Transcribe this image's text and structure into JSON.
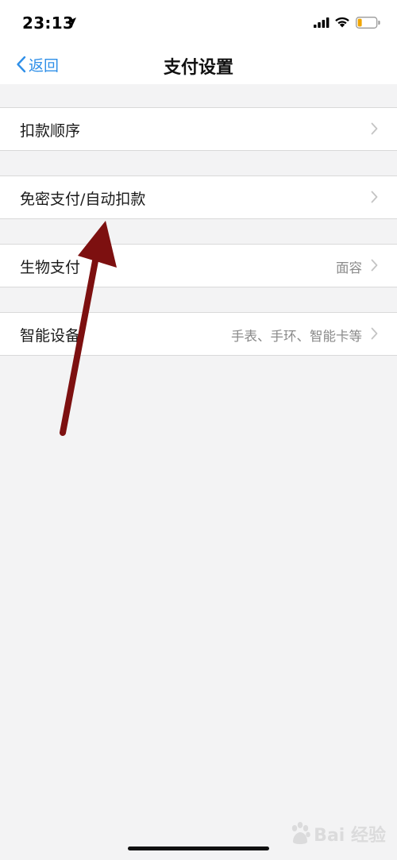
{
  "status_bar": {
    "time": "23:13",
    "location_icon": "location-arrow-icon",
    "signal_icon": "cellular-signal-icon",
    "wifi_icon": "wifi-icon",
    "battery_icon": "battery-low-icon",
    "battery_color": "#f0a500"
  },
  "nav": {
    "back_label": "返回",
    "back_icon": "chevron-left-icon",
    "title": "支付设置",
    "accent_color": "#2f8fe8"
  },
  "settings": {
    "items": [
      {
        "label": "扣款顺序",
        "value": ""
      },
      {
        "label": "免密支付/自动扣款",
        "value": ""
      },
      {
        "label": "生物支付",
        "value": "面容"
      },
      {
        "label": "智能设备",
        "value": "手表、手环、智能卡等"
      }
    ],
    "chevron_icon": "chevron-right-icon"
  },
  "annotation": {
    "arrow_icon": "red-arrow-annotation",
    "arrow_color": "#7d1010"
  },
  "watermark": {
    "logo_icon": "baidu-paw-icon",
    "text": "Bai 经验"
  }
}
